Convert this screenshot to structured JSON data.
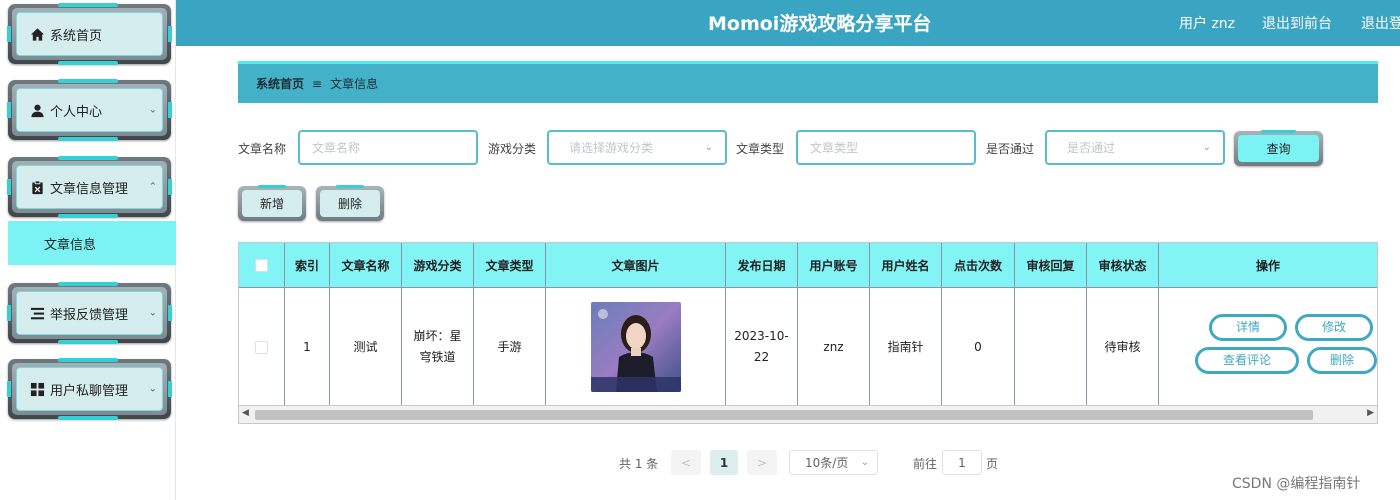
{
  "header": {
    "title": "Momoi游戏攻略分享平台",
    "user_link": "用户 znz",
    "front_link": "退出到前台",
    "logout_link": "退出登录"
  },
  "sidebar": {
    "items": [
      {
        "label": "系统首页",
        "icon": "home-icon"
      },
      {
        "label": "个人中心",
        "icon": "user-icon",
        "chevron": "chevron-down-icon"
      },
      {
        "label": "文章信息管理",
        "icon": "clipboard-icon",
        "chevron": "chevron-up-icon"
      },
      {
        "label": "举报反馈管理",
        "icon": "list-icon",
        "chevron": "chevron-down-icon"
      },
      {
        "label": "用户私聊管理",
        "icon": "grid-icon",
        "chevron": "chevron-down-icon"
      }
    ],
    "submenu_active": "文章信息"
  },
  "breadcrumb": {
    "home": "系统首页",
    "current": "文章信息"
  },
  "search": {
    "name_label": "文章名称",
    "name_placeholder": "文章名称",
    "category_label": "游戏分类",
    "category_placeholder": "请选择游戏分类",
    "type_label": "文章类型",
    "type_placeholder": "文章类型",
    "approved_label": "是否通过",
    "approved_placeholder": "是否通过",
    "query_button": "查询",
    "add_button": "新增",
    "delete_button": "删除"
  },
  "table": {
    "columns": [
      "索引",
      "文章名称",
      "游戏分类",
      "文章类型",
      "文章图片",
      "发布日期",
      "用户账号",
      "用户姓名",
      "点击次数",
      "审核回复",
      "审核状态",
      "操作"
    ],
    "rows": [
      {
        "index": "1",
        "name": "测试",
        "category": "崩坏：星穹铁道",
        "type": "手游",
        "date": "2023-10-22",
        "account": "znz",
        "username": "指南针",
        "clicks": "0",
        "reply": "",
        "status": "待审核"
      }
    ],
    "actions": {
      "detail": "详情",
      "edit": "修改",
      "comments": "查看评论",
      "delete": "删除"
    }
  },
  "pagination": {
    "total": "共 1 条",
    "current_page": "1",
    "page_size": "10条/页",
    "goto_label": "前往",
    "goto_value": "1",
    "page_suffix": "页"
  },
  "watermark": "CSDN @编程指南针",
  "colors": {
    "header": "#3aa4c3",
    "accent_cyan": "#7bf2f3",
    "table_header": "#82f4f5",
    "button_border": "#3fa9c1"
  }
}
